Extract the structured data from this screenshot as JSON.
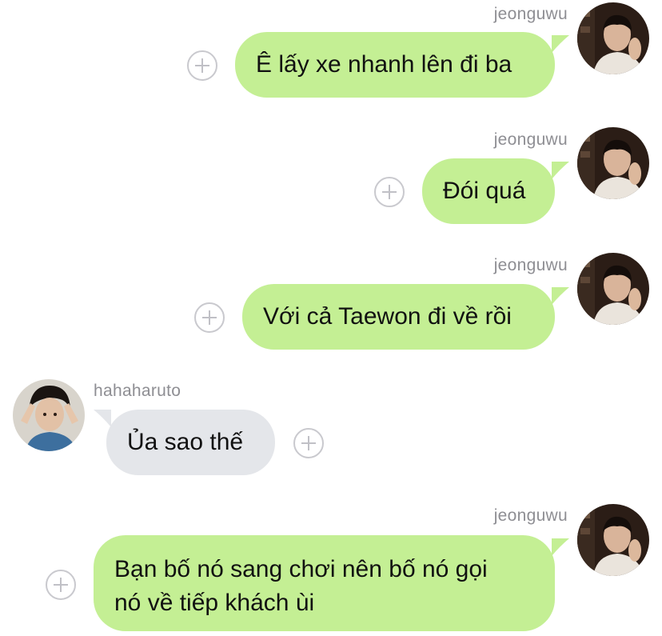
{
  "chat": {
    "messages": [
      {
        "direction": "outgoing",
        "sender": "jeonguwu",
        "lines": [
          "Ê lấy xe nhanh lên đi ba"
        ]
      },
      {
        "direction": "outgoing",
        "sender": "jeonguwu",
        "lines": [
          "Đói quá"
        ]
      },
      {
        "direction": "outgoing",
        "sender": "jeonguwu",
        "lines": [
          "Với cả Taewon đi về rồi"
        ]
      },
      {
        "direction": "incoming",
        "sender": "hahaharuto",
        "lines": [
          "Ủa sao thế"
        ]
      },
      {
        "direction": "outgoing",
        "sender": "jeonguwu",
        "lines": [
          "Bạn bố nó sang chơi nên bố nó gọi",
          "nó về tiếp khách ùi"
        ]
      }
    ]
  },
  "icons": {
    "reaction": "plus-circle-icon",
    "avatar": "user-avatar-photo"
  },
  "colors": {
    "outgoing_bubble": "#c4ef94",
    "incoming_bubble": "#e4e6ea",
    "sender_name": "#8e8e93",
    "text": "#111111",
    "reaction_button": "#c9c9ce"
  }
}
